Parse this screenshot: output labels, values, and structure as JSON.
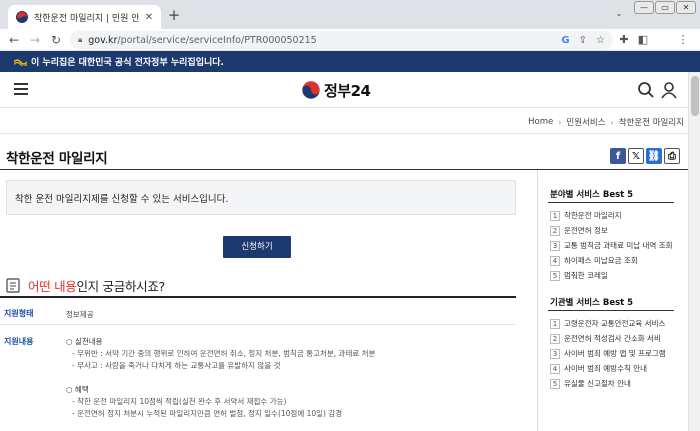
{
  "browser": {
    "tab_title": "착한운전 마일리지 | 민원 안내",
    "tab_close": "✕",
    "new_tab": "+",
    "url_host": "gov.kr",
    "url_path": "/portal/service/serviceInfo/PTR000050215"
  },
  "gov_banner": {
    "text": "이 누리집은 대한민국 공식 전자정부 누리집입니다."
  },
  "header": {
    "logo_text": "정부24"
  },
  "breadcrumb": {
    "items": [
      "Home",
      "민원서비스",
      "착한운전 마일리지"
    ]
  },
  "page": {
    "title": "착한운전 마일리지",
    "summary": "착한 운전 마일리지제를 신청할 수 있는 서비스입니다.",
    "apply_button": "신청하기",
    "section_title_highlight": "어떤 내용",
    "section_title_rest": "인지 궁금하시죠?",
    "rows": {
      "support_type_label": "지원형태",
      "support_type_value": "정보제공",
      "support_content_label": "지원내용"
    },
    "details": [
      "○ 실천내용",
      "- 무위반 : 서약 기간 중의 행위로 인하여 운전면허 취소, 정지 처분, 범칙금 통고처분, 과태료 처분",
      "- 무사고 : 사람을 죽거나 다치게 하는 교통사고를 유발하지 않을 것",
      "○ 혜택",
      "- 착한 운전 마일리지 10점씩 적립(실천 완수 후 서약서 재접수 가능)",
      "- 운전면허 정지 처분시 누적된 마일리지만큼 면허 벌점, 정지 일수(10점에 10일) 감경"
    ]
  },
  "sidebar": {
    "field_title": "분야별 서비스 Best 5",
    "field_items": [
      {
        "num": "1",
        "label": "착한운전 마일리지"
      },
      {
        "num": "2",
        "label": "운전면허 정보"
      },
      {
        "num": "3",
        "label": "교통 범칙금 과태료 미납 내역 조회"
      },
      {
        "num": "4",
        "label": "하이패스 미납요금 조회"
      },
      {
        "num": "5",
        "label": "멈춰한 코레일"
      }
    ],
    "agency_title": "기관별 서비스 Best 5",
    "agency_items": [
      {
        "num": "1",
        "label": "고령운전자 교통안전교육 서비스"
      },
      {
        "num": "2",
        "label": "운전면허 적성검사 간소화 서비"
      },
      {
        "num": "3",
        "label": "사이버 범죄 예방 앱 및 프로그램"
      },
      {
        "num": "4",
        "label": "사이버 범죄 예방수칙 안내"
      },
      {
        "num": "5",
        "label": "유실물 신고절차 안내"
      }
    ]
  },
  "colors": {
    "banner": "#1d3a6e",
    "highlight": "#e0312a",
    "label_blue": "#1d4fa0"
  }
}
